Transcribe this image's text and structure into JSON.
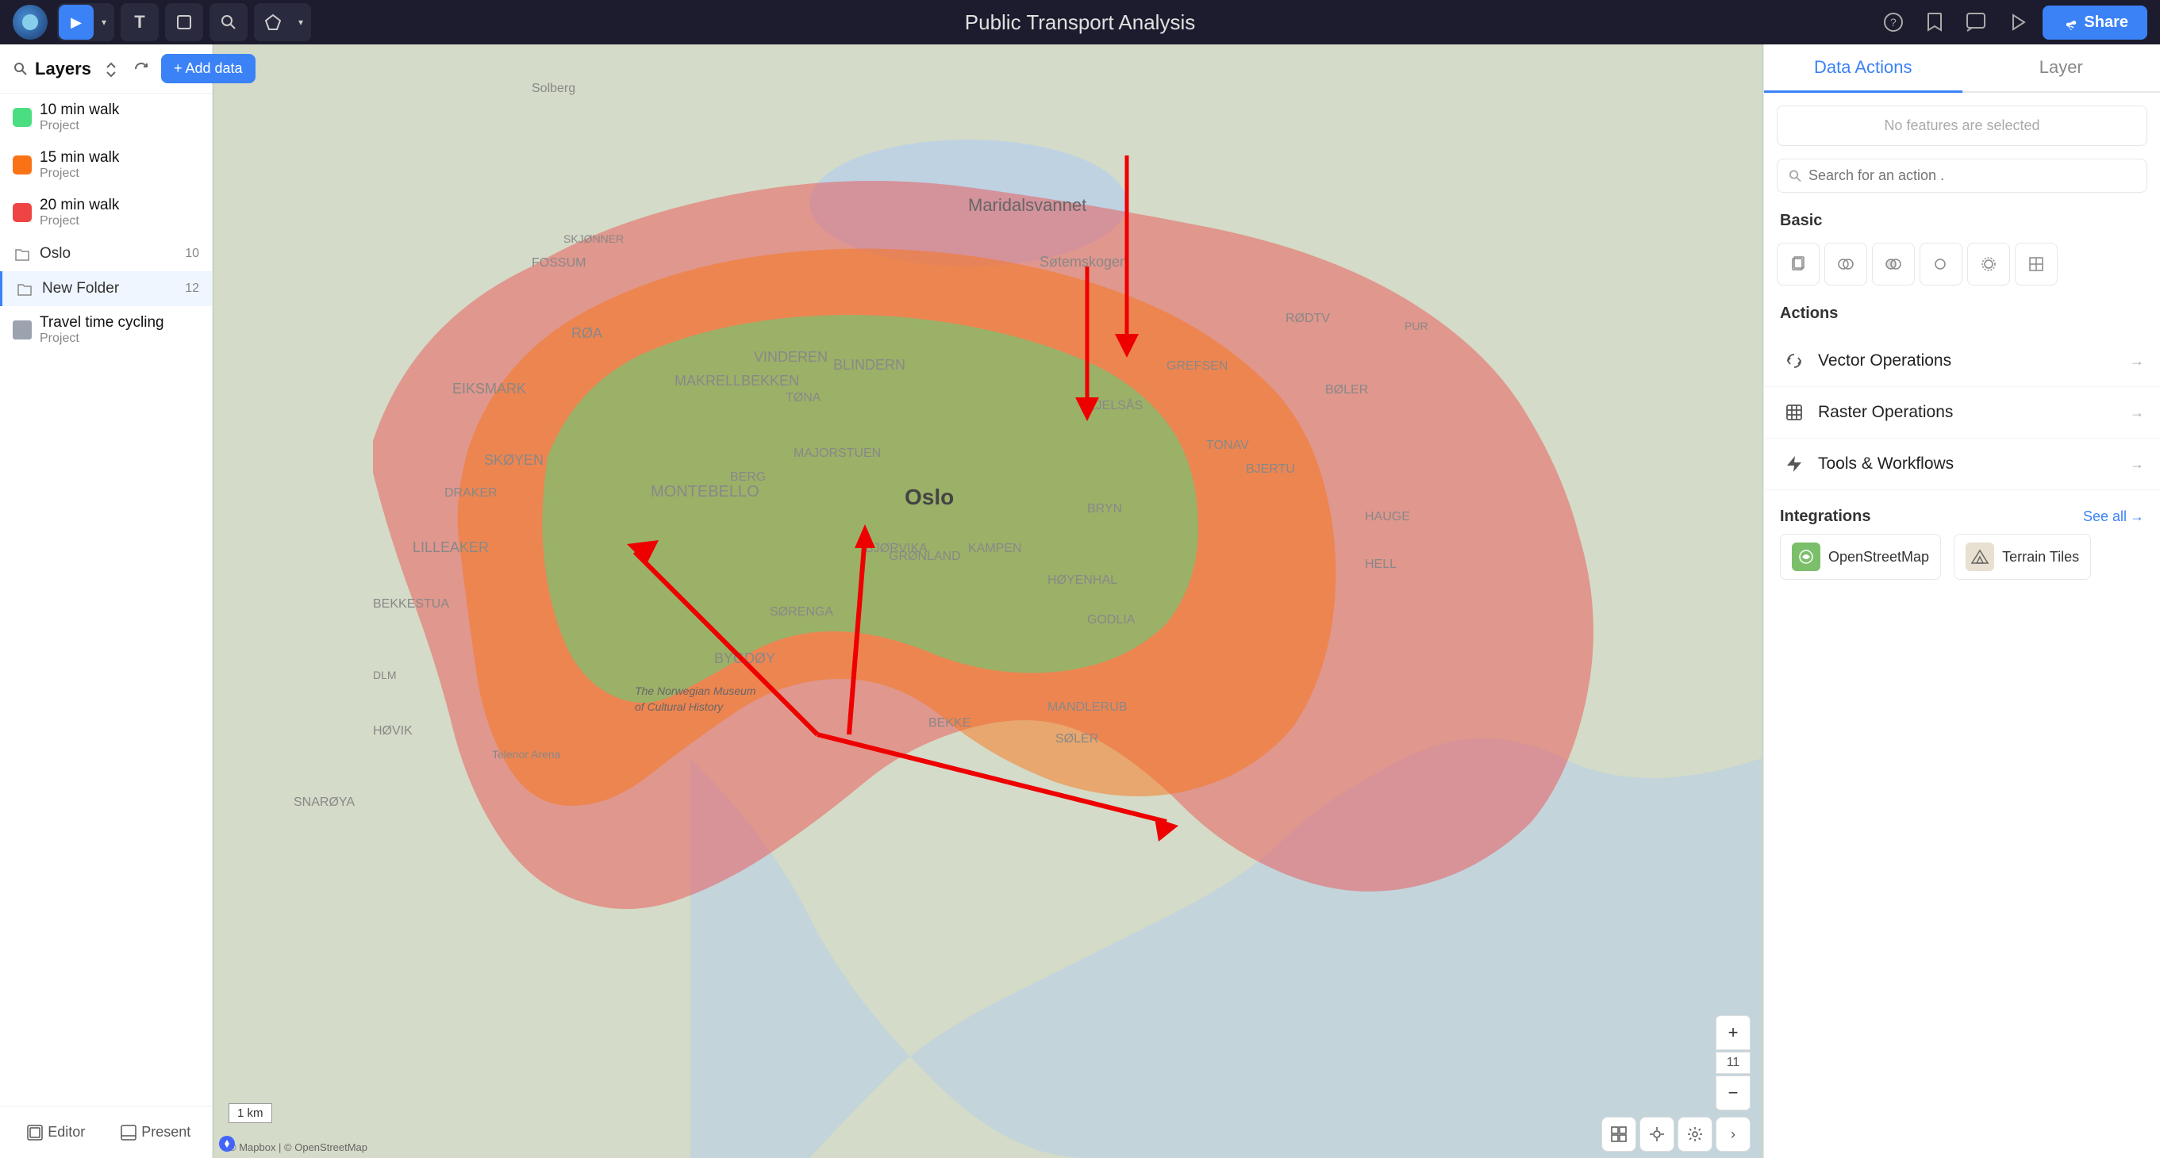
{
  "topbar": {
    "title": "Public Transport Analysis",
    "share_label": "Share",
    "tools": [
      {
        "name": "select-tool",
        "icon": "▶",
        "active": true
      },
      {
        "name": "text-tool",
        "icon": "T",
        "active": false
      },
      {
        "name": "shape-tool",
        "icon": "◻",
        "active": false
      },
      {
        "name": "search-tool",
        "icon": "⌕",
        "active": false
      },
      {
        "name": "marker-tool",
        "icon": "◈",
        "active": false
      }
    ]
  },
  "left_sidebar": {
    "title": "Layers",
    "add_data_label": "+ Add data",
    "layers": [
      {
        "name": "10 min walk",
        "sub": "Project",
        "color": "#4ade80",
        "type": "layer"
      },
      {
        "name": "15 min walk",
        "sub": "Project",
        "color": "#f97316",
        "type": "layer"
      },
      {
        "name": "20 min walk",
        "sub": "Project",
        "color": "#ef4444",
        "type": "layer"
      },
      {
        "name": "Oslo",
        "sub": "",
        "count": "10",
        "type": "folder"
      },
      {
        "name": "New Folder",
        "sub": "",
        "count": "12",
        "type": "folder",
        "selected": true
      },
      {
        "name": "Travel time cycling",
        "sub": "Project",
        "color": "#9ca3af",
        "type": "layer"
      }
    ],
    "footer": [
      {
        "name": "editor-btn",
        "icon": "⊞",
        "label": "Editor"
      },
      {
        "name": "present-btn",
        "icon": "⊟",
        "label": "Present"
      }
    ]
  },
  "right_sidebar": {
    "tabs": [
      {
        "name": "data-actions-tab",
        "label": "Data Actions",
        "active": true
      },
      {
        "name": "layer-tab",
        "label": "Layer",
        "active": false
      }
    ],
    "no_features_text": "No features are selected",
    "search_placeholder": "Search for an action .",
    "basic_label": "Basic",
    "basic_icons": [
      {
        "name": "basic-icon-1",
        "icon": "⊡"
      },
      {
        "name": "basic-icon-2",
        "icon": "◎"
      },
      {
        "name": "basic-icon-3",
        "icon": "⊕"
      },
      {
        "name": "basic-icon-4",
        "icon": "⊗"
      },
      {
        "name": "basic-icon-5",
        "icon": "✦"
      },
      {
        "name": "basic-icon-6",
        "icon": "⊞"
      }
    ],
    "actions_label": "Actions",
    "actions": [
      {
        "name": "vector-operations",
        "label": "Vector Operations",
        "icon": "↺"
      },
      {
        "name": "raster-operations",
        "label": "Raster Operations",
        "icon": "⊞"
      },
      {
        "name": "tools-workflows",
        "label": "Tools & Workflows",
        "icon": "⚡"
      }
    ],
    "integrations_label": "Integrations",
    "see_all_label": "See all",
    "integrations": [
      {
        "name": "openstreetmap",
        "label": "OpenStreetMap",
        "icon_type": "osm"
      },
      {
        "name": "terrain-tiles",
        "label": "Terrain Tiles",
        "icon_type": "terrain"
      }
    ]
  },
  "map": {
    "zoom_level": "11",
    "scale_label": "1 km",
    "credit": "© Mapbox | © OpenStreetMap"
  }
}
